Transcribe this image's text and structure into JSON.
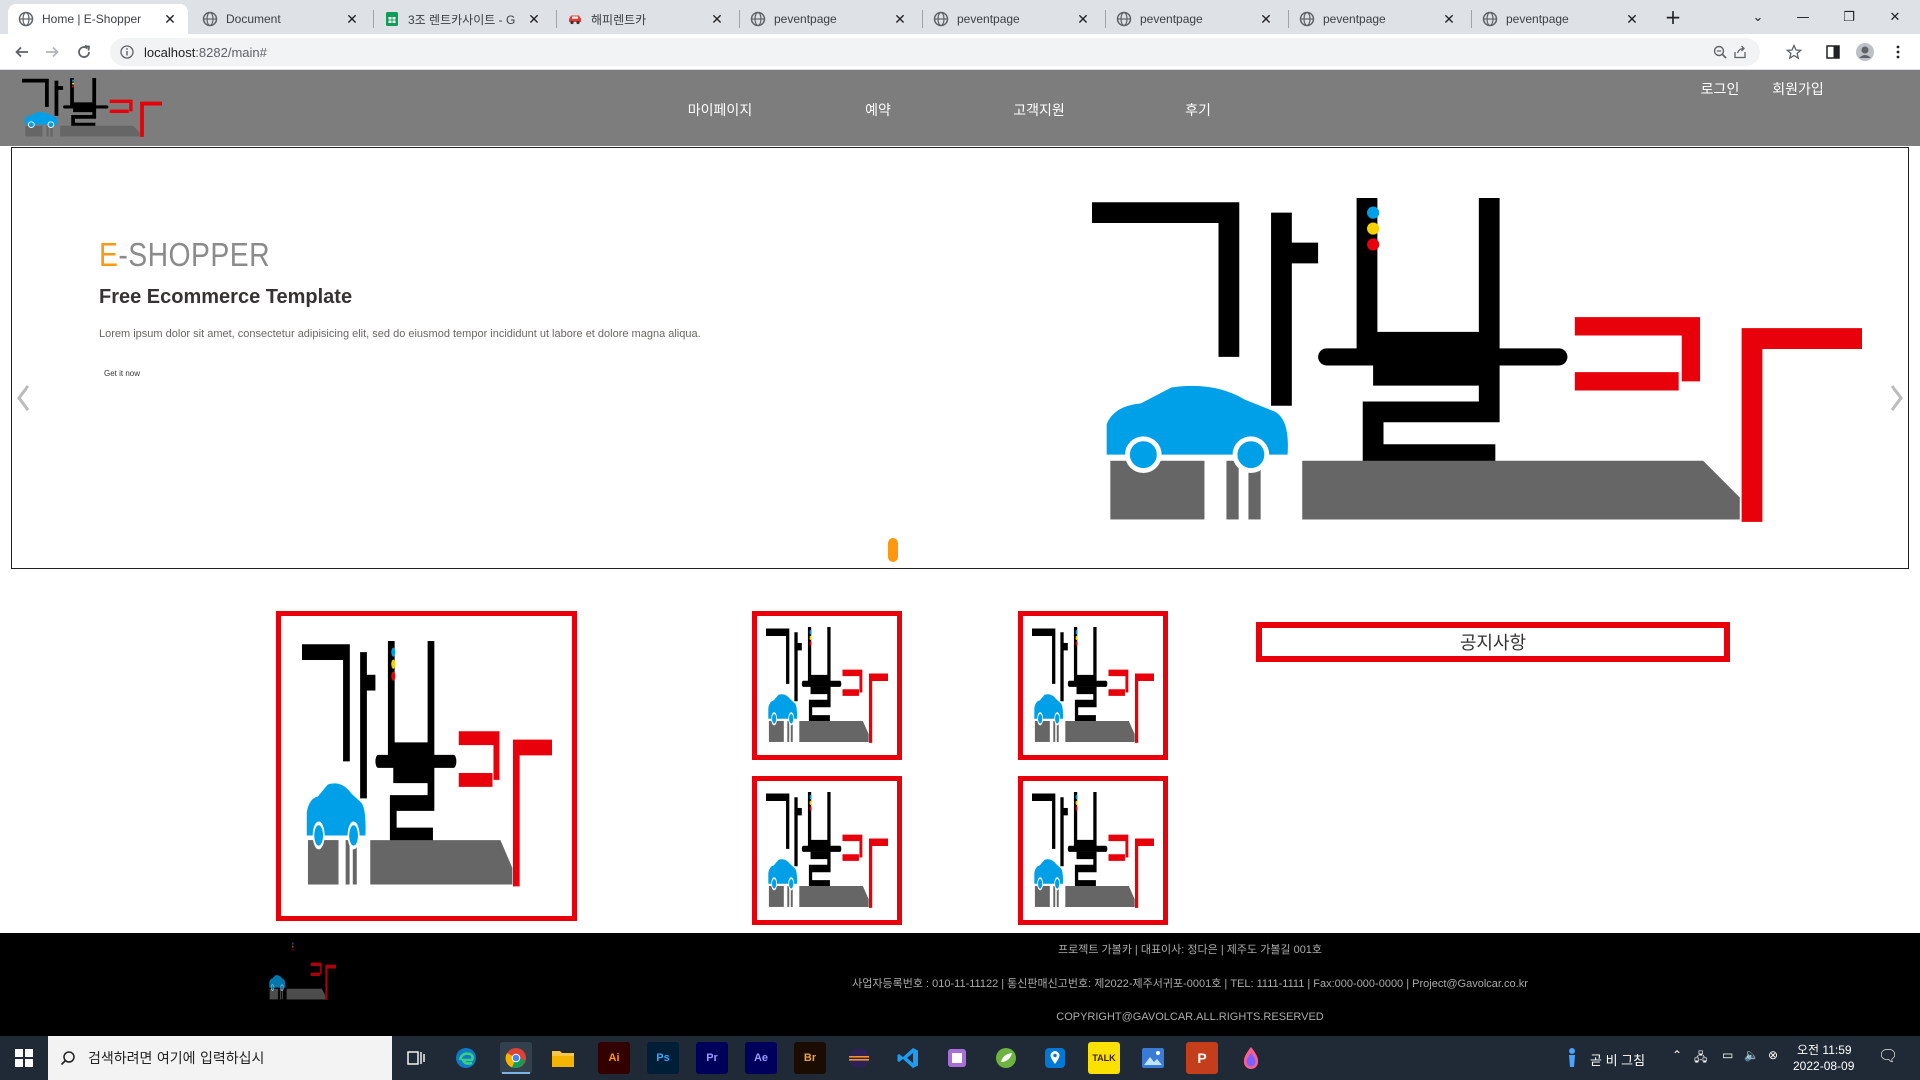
{
  "browser": {
    "tabs": [
      {
        "title": "Home | E-Shopper",
        "icon": "globe-icon",
        "active": true
      },
      {
        "title": "Document",
        "icon": "globe-icon",
        "active": false
      },
      {
        "title": "3조 렌트카사이트 - G",
        "icon": "sheets-icon",
        "active": false
      },
      {
        "title": "해피렌트카",
        "icon": "car-icon",
        "active": false
      },
      {
        "title": "peventpage",
        "icon": "globe-icon",
        "active": false
      },
      {
        "title": "peventpage",
        "icon": "globe-icon",
        "active": false
      },
      {
        "title": "peventpage",
        "icon": "globe-icon",
        "active": false
      },
      {
        "title": "peventpage",
        "icon": "globe-icon",
        "active": false
      },
      {
        "title": "peventpage",
        "icon": "globe-icon",
        "active": false
      }
    ],
    "new_tab_label": "+",
    "url_host": "localhost",
    "url_rest": ":8282/main#"
  },
  "site": {
    "logo_text": "가볼카",
    "nav": [
      {
        "label": "마이페이지"
      },
      {
        "label": "예약"
      },
      {
        "label": "고객지원"
      },
      {
        "label": "후기"
      }
    ],
    "login_label": "로그인",
    "signup_label": "회원가입"
  },
  "slider": {
    "heading_accent": "E",
    "heading_rest": "-SHOPPER",
    "subheading": "Free Ecommerce Template",
    "text": "Lorem ipsum dolor sit amet, consectetur adipisicing elit, sed do eiusmod tempor incididunt ut labore et dolore magna aliqua.",
    "button_label": "Get it now",
    "indicator_color": "#fe980f"
  },
  "notice": {
    "title": "공지사항"
  },
  "footer": {
    "line1": "프로젝트 가볼카 | 대표이사: 정다은 | 제주도 가볼길 001호",
    "line2": "사업자등록번호 : 010-11-11122 | 통신판매신고번호: 제2022-제주서귀포-0001호 | TEL: 1111-1111 | Fax:000-000-0000 | Project@Gavolcar.co.kr",
    "line3": "COPYRIGHT@GAVOLCAR.ALL.RIGHTS.RESERVED"
  },
  "taskbar": {
    "search_placeholder": "검색하려면 여기에 입력하십시",
    "apps": [
      {
        "name": "task-view-icon",
        "label": ""
      },
      {
        "name": "edge-icon",
        "label": ""
      },
      {
        "name": "chrome-icon",
        "label": ""
      },
      {
        "name": "file-explorer-icon",
        "label": ""
      },
      {
        "name": "illustrator-icon",
        "label": "Ai"
      },
      {
        "name": "photoshop-icon",
        "label": "Ps"
      },
      {
        "name": "premiere-icon",
        "label": "Pr"
      },
      {
        "name": "after-effects-icon",
        "label": "Ae"
      },
      {
        "name": "bridge-icon",
        "label": "Br"
      },
      {
        "name": "eclipse-icon",
        "label": ""
      },
      {
        "name": "vscode-icon",
        "label": ""
      },
      {
        "name": "notepad-icon",
        "label": ""
      },
      {
        "name": "spring-icon",
        "label": ""
      },
      {
        "name": "maps-icon",
        "label": ""
      },
      {
        "name": "kakaotalk-icon",
        "label": "TALK"
      },
      {
        "name": "photos-icon",
        "label": ""
      },
      {
        "name": "powerpoint-icon",
        "label": "P"
      },
      {
        "name": "paint-icon",
        "label": ""
      }
    ],
    "weather_text": "곧 비 그침",
    "time": "오전 11:59",
    "date": "2022-08-09"
  },
  "colors": {
    "header_bg": "#7d7d7d",
    "accent_red": "#e8000b",
    "accent_orange": "#fe980f",
    "logo_blue": "#00a0e9"
  }
}
